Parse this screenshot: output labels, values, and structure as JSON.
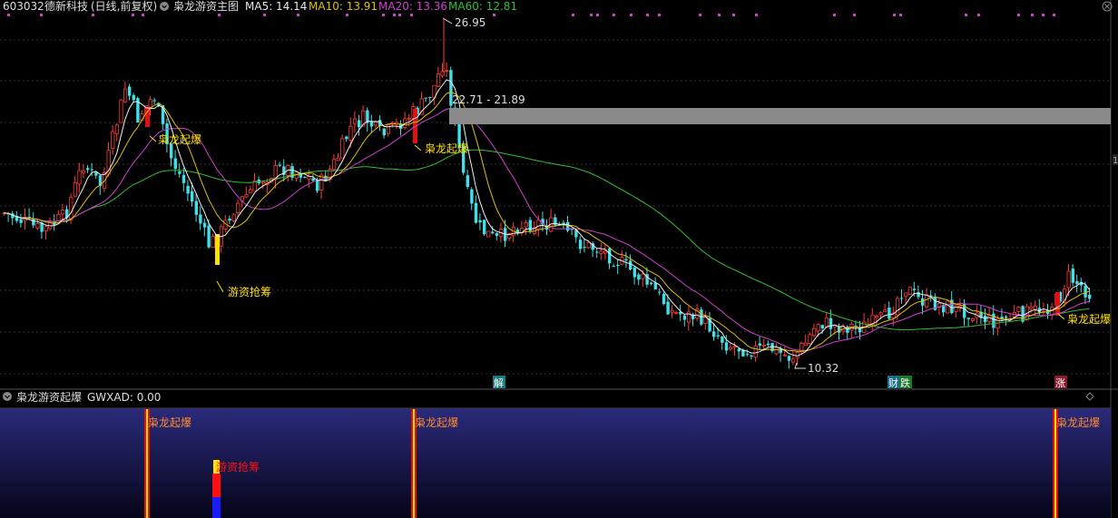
{
  "header": {
    "code": "603032",
    "name": "德新科技",
    "period": "(日线,前复权)",
    "indicator_title": "枭龙游资主图",
    "ma": [
      {
        "label": "MA5: 14.14",
        "color": "#e8e8e8"
      },
      {
        "label": "MA10: 13.91",
        "color": "#e0c000"
      },
      {
        "label": "MA20: 13.36",
        "color": "#d040d0"
      },
      {
        "label": "MA60: 12.81",
        "color": "#30c030"
      }
    ]
  },
  "main_chart": {
    "high_label": "26.95",
    "low_label": "10.32",
    "range_label": "22.71 - 21.89",
    "signals": [
      {
        "text": "枭龙起爆"
      },
      {
        "text": "游资抢筹"
      },
      {
        "text": "枭龙起爆"
      },
      {
        "text": "枭龙起爆"
      }
    ],
    "badges": [
      {
        "text": "解",
        "bg": "#1a7a7a"
      },
      {
        "text": "财",
        "bg": "#1a6a8a"
      },
      {
        "text": "跌",
        "bg": "#1a7a2a"
      },
      {
        "text": "涨",
        "bg": "#8a1a2a"
      }
    ],
    "right_marker": "1"
  },
  "sub_panel": {
    "title": "枭龙游资起爆",
    "value": "GWXAD: 0.00",
    "labels": [
      {
        "text": "枭龙起爆"
      },
      {
        "text": "枭龙起爆"
      },
      {
        "text": "枭龙起爆"
      },
      {
        "text": "游资抢筹"
      }
    ]
  },
  "colors": {
    "up": "#ff3a3a",
    "down": "#40e0e8",
    "signal_text": "#ffe000",
    "sub_label": "#ff8a30",
    "panel_top": "#2a2a7a",
    "panel_bottom": "#000000"
  },
  "icons": {
    "collapse": "chevron-down-circle-icon",
    "close": "close-circle-icon",
    "diamond": "diamond-icon"
  }
}
